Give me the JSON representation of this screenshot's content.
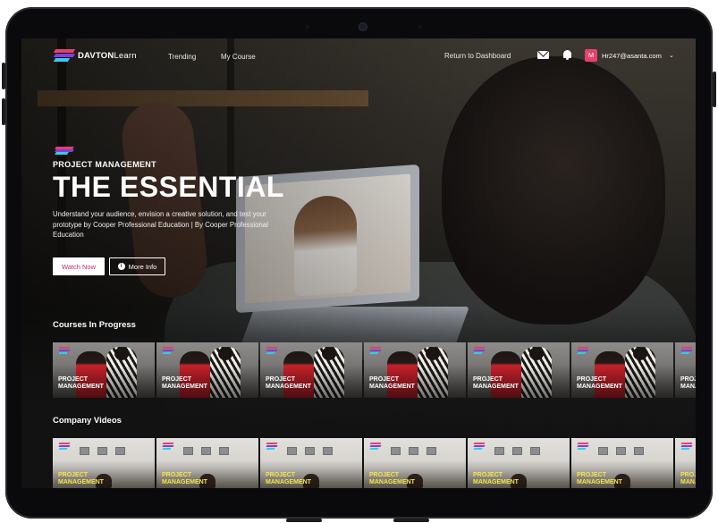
{
  "brand": {
    "name_bold": "DAVTON",
    "name_light": "Learn",
    "colors": {
      "pink": "#e5416b",
      "purple": "#7b3fe4",
      "cyan": "#3cc8e8",
      "watch_text": "#c02a73",
      "card_label_white": "#ffffff",
      "card_label_yellow": "#f5e64a"
    }
  },
  "nav": {
    "links": [
      "Trending",
      "My Course"
    ],
    "return_label": "Return to Dashboard",
    "mail_icon": "envelope-icon",
    "bell_icon": "bell-icon",
    "avatar_initial": "M",
    "user_email": "Hr247@asanta.com",
    "dropdown_glyph": "⌄"
  },
  "hero": {
    "eyebrow": "PROJECT MANAGEMENT",
    "title": "THE ESSENTIAL",
    "description": "Understand your audience, envision a creative solution, and test your prototype by Cooper Professional Education | By Cooper Professional Education",
    "watch_label": "Watch Now",
    "info_label": "More Info",
    "info_glyph": "i"
  },
  "sections": [
    {
      "title": "Courses In Progress",
      "cards": [
        {
          "line1": "PROJECT",
          "line2": "MANAGEMENT"
        },
        {
          "line1": "PROJECT",
          "line2": "MANAGEMENT"
        },
        {
          "line1": "PROJECT",
          "line2": "MANAGEMENT"
        },
        {
          "line1": "PROJECT",
          "line2": "MANAGEMENT"
        },
        {
          "line1": "PROJECT",
          "line2": "MANAGEMENT"
        },
        {
          "line1": "PROJECT",
          "line2": "MANAGEMENT"
        },
        {
          "line1": "PROJECT",
          "line2": "MANAGEMENT"
        }
      ]
    },
    {
      "title": "Company Videos",
      "cards": [
        {
          "line1": "PROJECT",
          "line2": "MANAGEMENT"
        },
        {
          "line1": "PROJECT",
          "line2": "MANAGEMENT"
        },
        {
          "line1": "PROJECT",
          "line2": "MANAGEMENT"
        },
        {
          "line1": "PROJECT",
          "line2": "MANAGEMENT"
        },
        {
          "line1": "PROJECT",
          "line2": "MANAGEMENT"
        },
        {
          "line1": "PROJECT",
          "line2": "MANAGEMENT"
        },
        {
          "line1": "PROJECT",
          "line2": "MANAGEMENT"
        }
      ]
    }
  ]
}
